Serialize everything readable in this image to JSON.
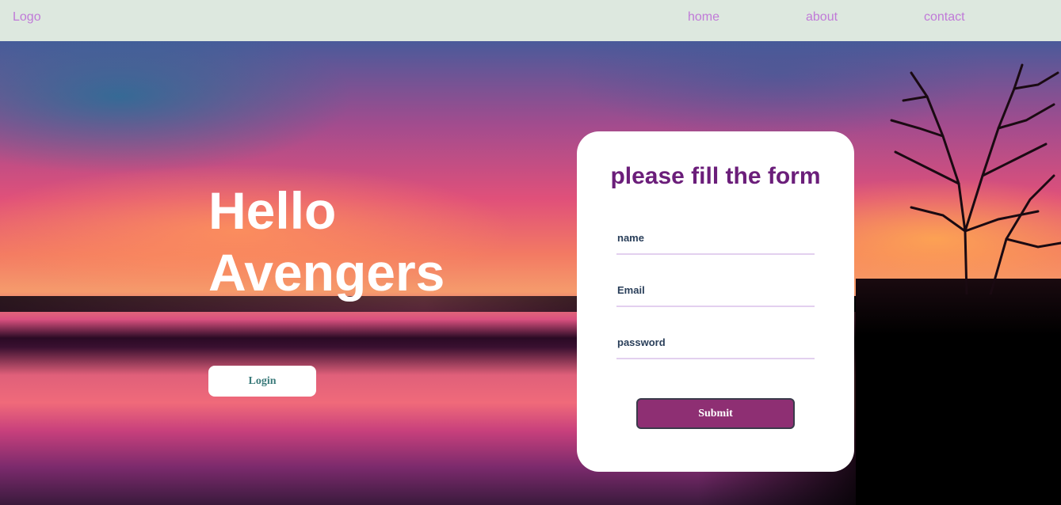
{
  "navbar": {
    "logo": "Logo",
    "links": [
      "home",
      "about",
      "contact"
    ]
  },
  "hero": {
    "title_line1": "Hello",
    "title_line2": "Avengers",
    "login_label": "Login"
  },
  "form": {
    "title": "please fill the form",
    "name_placeholder": "name",
    "email_placeholder": "Email",
    "password_placeholder": "password",
    "submit_label": "Submit"
  },
  "colors": {
    "navbar_bg": "#dde8df",
    "nav_link": "#c07ad8",
    "form_title": "#6b1e7a",
    "submit_bg": "#8e2f73"
  }
}
